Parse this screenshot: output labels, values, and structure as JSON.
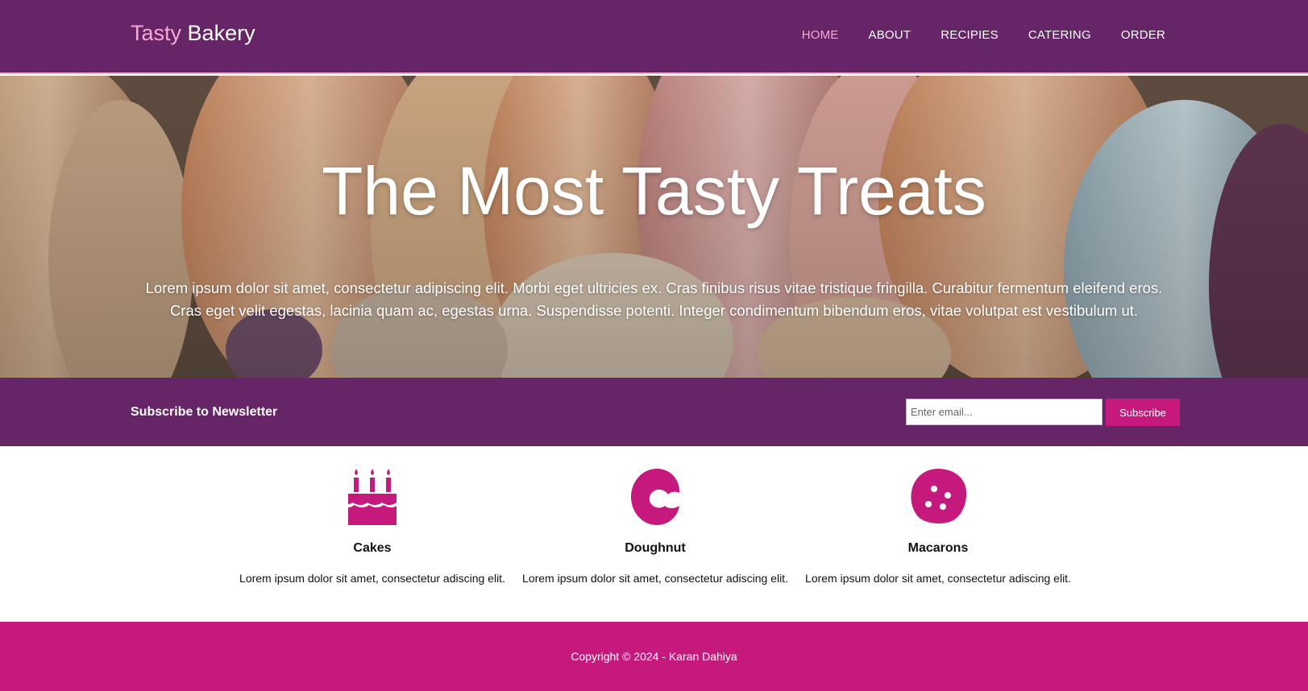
{
  "header": {
    "logo_part1": "Tasty",
    "logo_part2": "Bakery",
    "nav": [
      "HOME",
      "ABOUT",
      "RECIPIES",
      "CATERING",
      "ORDER"
    ]
  },
  "hero": {
    "title": "The Most Tasty Treats",
    "text": "Lorem ipsum dolor sit amet, consectetur adipiscing elit. Morbi eget ultricies ex. Cras finibus risus vitae tristique fringilla. Curabitur fermentum eleifend eros. Cras eget velit egestas, lacinia quam ac, egestas urna. Suspendisse potenti. Integer condimentum bibendum eros, vitae volutpat est vestibulum ut."
  },
  "newsletter": {
    "label": "Subscribe to Newsletter",
    "placeholder": "Enter email...",
    "button": "Subscribe"
  },
  "features": [
    {
      "icon": "birthday-cake-icon",
      "title": "Cakes",
      "text": "Lorem ipsum dolor sit amet, consectetur adiscing elit."
    },
    {
      "icon": "doughnut-icon",
      "title": "Doughnut",
      "text": "Lorem ipsum dolor sit amet, consectetur adiscing elit."
    },
    {
      "icon": "cookie-icon",
      "title": "Macarons",
      "text": "Lorem ipsum dolor sit amet, consectetur adiscing elit."
    }
  ],
  "footer": {
    "copyright": "Copyright © 2024 - Karan Dahiya"
  },
  "colors": {
    "primary": "#662567",
    "accent": "#c5197d",
    "pink": "#f7a8d3"
  }
}
